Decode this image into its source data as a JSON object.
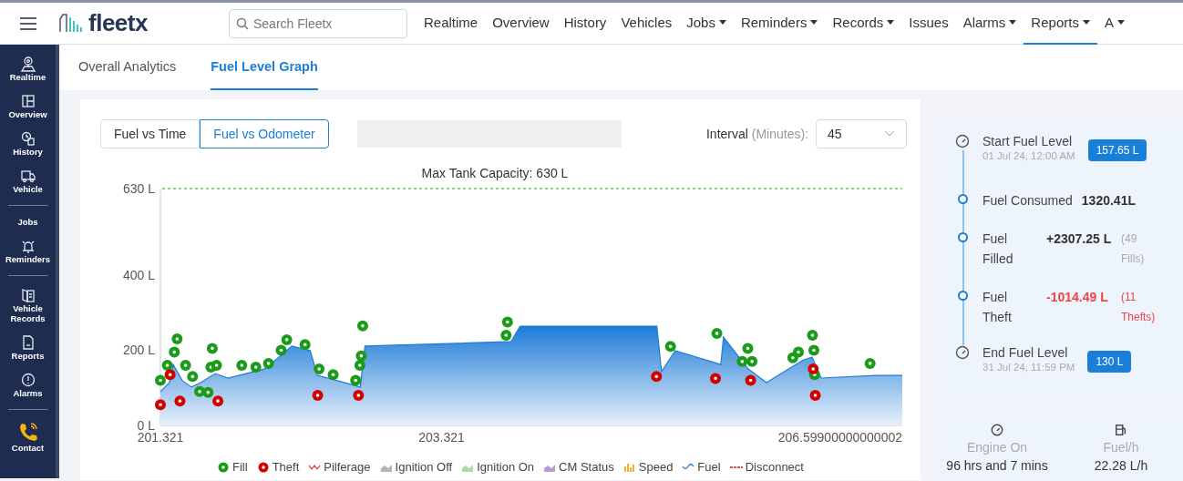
{
  "topbar": {
    "logo": "fleetx",
    "search": {
      "placeholder": "Search Fleetx"
    },
    "nav": [
      {
        "label": "Realtime",
        "dropdown": false,
        "selected": false
      },
      {
        "label": "Overview",
        "dropdown": false,
        "selected": false
      },
      {
        "label": "History",
        "dropdown": false,
        "selected": false
      },
      {
        "label": "Vehicles",
        "dropdown": false,
        "selected": false
      },
      {
        "label": "Jobs",
        "dropdown": true,
        "selected": false
      },
      {
        "label": "Reminders",
        "dropdown": true,
        "selected": false
      },
      {
        "label": "Records",
        "dropdown": true,
        "selected": false
      },
      {
        "label": "Issues",
        "dropdown": false,
        "selected": false
      },
      {
        "label": "Alarms",
        "dropdown": true,
        "selected": false
      },
      {
        "label": "Reports",
        "dropdown": true,
        "selected": true
      },
      {
        "label": "A",
        "dropdown": true,
        "selected": false
      }
    ]
  },
  "sidebar": {
    "groups": [
      [
        {
          "label": "Realtime",
          "kind": "pin"
        },
        {
          "label": "Overview",
          "kind": "layout"
        },
        {
          "label": "History",
          "kind": "clock"
        },
        {
          "label": "Vehicle",
          "kind": "truck"
        }
      ],
      [
        {
          "label": "Jobs",
          "kind": "none"
        },
        {
          "label": "Reminders",
          "kind": "bell"
        }
      ],
      [
        {
          "label": "Vehicle Records",
          "kind": "book"
        },
        {
          "label": "Reports",
          "kind": "doc"
        },
        {
          "label": "Alarms",
          "kind": "alert"
        }
      ],
      [
        {
          "label": "Contact",
          "kind": "phone"
        }
      ]
    ]
  },
  "tabs": [
    {
      "label": "Overall Analytics",
      "selected": false
    },
    {
      "label": "Fuel Level Graph",
      "selected": true
    }
  ],
  "graph": {
    "modes": [
      {
        "label": "Fuel vs Time",
        "selected": false
      },
      {
        "label": "Fuel vs Odometer",
        "selected": true
      }
    ],
    "interval": {
      "label": "Interval",
      "unit": "(Minutes):",
      "value": "45"
    },
    "chart_data": {
      "type": "area",
      "title": "Max Tank Capacity: 630 L",
      "xlim": [
        201.321,
        206.599
      ],
      "ylim": [
        0,
        630
      ],
      "xticks": [
        {
          "value": 201.321,
          "label": "201.321"
        },
        {
          "value": 203.321,
          "label": "203.321"
        },
        {
          "value": 206.599,
          "label": "206.59900000000002"
        }
      ],
      "yticks": [
        {
          "value": 0,
          "label": "0 L"
        },
        {
          "value": 200,
          "label": "200 L"
        },
        {
          "value": 400,
          "label": "400 L"
        },
        {
          "value": 630,
          "label": "630 L"
        }
      ],
      "x": [
        201.321,
        201.386,
        201.412,
        201.477,
        201.542,
        201.607,
        201.711,
        201.802,
        201.931,
        202.061,
        202.159,
        202.256,
        202.386,
        202.438,
        202.581,
        202.743,
        202.776,
        203.815,
        203.88,
        204.853,
        204.886,
        204.983,
        205.308,
        205.327,
        205.503,
        205.633,
        205.893,
        205.957,
        206.022,
        206.412,
        206.599
      ],
      "series": [
        {
          "name": "Fuel",
          "color": "#1e7bd6",
          "values": [
            90,
            114,
            162,
            119,
            102,
            114,
            138,
            126,
            138,
            150,
            180,
            211,
            199,
            133,
            119,
            102,
            211,
            223,
            264,
            264,
            143,
            199,
            162,
            235,
            150,
            114,
            174,
            182,
            126,
            133,
            133
          ]
        }
      ]
    },
    "events": {
      "chart_data": {
        "type": "scatter",
        "xlim": [
          201.321,
          206.599
        ],
        "ylim": [
          0,
          630
        ],
        "x": [
          201.321,
          201.37,
          201.39,
          201.42,
          201.44,
          201.46,
          201.5,
          201.55,
          201.6,
          201.66,
          201.68,
          201.69,
          201.72,
          201.73,
          201.9,
          202.0,
          202.09,
          202.18,
          202.22,
          202.35,
          202.44,
          202.45,
          202.55,
          202.71,
          202.73,
          202.74,
          202.75,
          202.76,
          203.78,
          203.79,
          204.85,
          204.95,
          205.27,
          205.28,
          205.46,
          205.5,
          205.52,
          205.53,
          205.82,
          205.86,
          205.96,
          205.965,
          205.97,
          205.975,
          205.98,
          206.37
        ],
        "series": [
          {
            "name": "Fill",
            "color": "#1a9c1a",
            "values": [
              120,
              160,
              null,
              195,
              230,
              null,
              160,
              130,
              90,
              88,
              155,
              205,
              160,
              null,
              160,
              155,
              165,
              200,
              228,
              215,
              null,
              150,
              135,
              120,
              null,
              160,
              185,
              265,
              240,
              275,
              null,
              210,
              null,
              245,
              170,
              205,
              null,
              170,
              180,
              195,
              240,
              null,
              200,
              135,
              null,
              165
            ]
          },
          {
            "name": "Theft",
            "color": "#d40000",
            "values": [
              55,
              null,
              135,
              null,
              null,
              65,
              null,
              null,
              null,
              null,
              null,
              null,
              null,
              65,
              null,
              null,
              null,
              null,
              null,
              null,
              80,
              null,
              null,
              null,
              80,
              null,
              null,
              null,
              null,
              null,
              130,
              null,
              125,
              null,
              null,
              null,
              120,
              null,
              null,
              null,
              null,
              150,
              null,
              null,
              80,
              null
            ]
          }
        ]
      }
    },
    "legend": [
      {
        "kind": "dot"
      },
      {
        "kind": "dot"
      },
      {
        "label": "Pilferage",
        "kind": "zigzag",
        "color": "#e05050"
      },
      {
        "label": "Ignition Off",
        "kind": "area",
        "color": "#b5b5b5"
      },
      {
        "label": "Ignition On",
        "kind": "area",
        "color": "#a8dca8"
      },
      {
        "label": "CM Status",
        "kind": "area",
        "color": "#b79bd8"
      },
      {
        "label": "Speed",
        "kind": "bars",
        "color": "#f0b030"
      },
      {
        "kind": "wave"
      },
      {
        "label": "Disconnect",
        "kind": "dashed",
        "color": "#e05050"
      }
    ]
  },
  "summary": [
    {
      "kind": "endpoint",
      "title": "Start Fuel Level",
      "date": "01 Jul 24, 12:00 AM",
      "value": "157.65 L"
    },
    {
      "kind": "stat",
      "title": "Fuel Consumed",
      "value": "1320.41L",
      "alert": false
    },
    {
      "kind": "stat",
      "title": "Fuel Filled",
      "value": "+2307.25 L",
      "note": "(49 Fills)",
      "alert": false
    },
    {
      "kind": "stat",
      "title": "Fuel Theft",
      "value": "-1014.49 L",
      "note": "(11 Thefts)",
      "alert": true
    },
    {
      "kind": "endpoint",
      "title": "End Fuel Level",
      "date": "31 Jul 24, 11:59 PM",
      "value": "130 L"
    }
  ],
  "stats": [
    {
      "kind": "engine",
      "label": "Engine On",
      "value": "96 hrs and 7 mins"
    },
    {
      "kind": "pump",
      "label": "Fuel/h",
      "value": "22.28 L/h"
    }
  ]
}
